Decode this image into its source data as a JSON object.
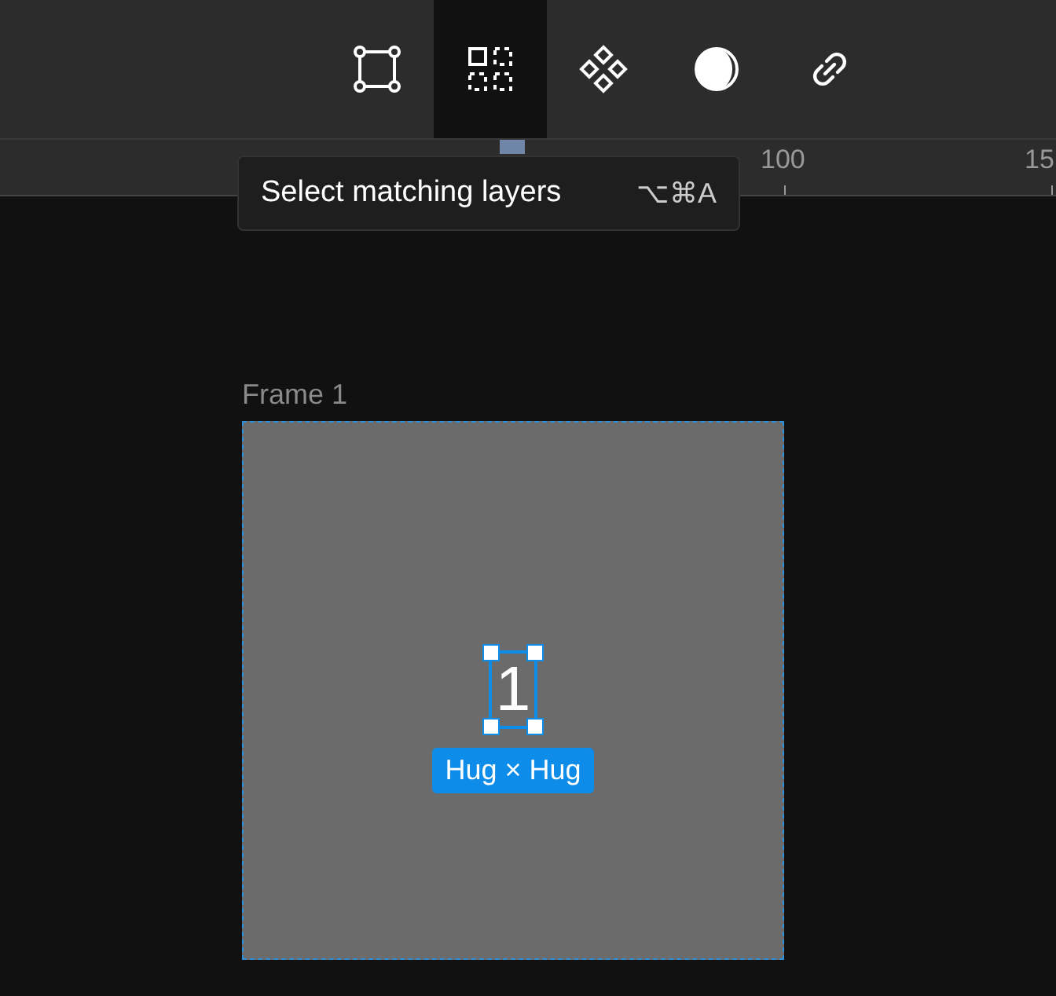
{
  "toolbar": {
    "buttons": [
      {
        "selected": false
      },
      {
        "selected": true
      },
      {
        "selected": false
      },
      {
        "selected": false
      },
      {
        "selected": false
      }
    ]
  },
  "ruler": {
    "labels": [
      {
        "text": "100"
      },
      {
        "text": "15"
      }
    ]
  },
  "tooltip": {
    "label": "Select matching layers",
    "shortcut": "⌥⌘A"
  },
  "canvas": {
    "frame": {
      "title": "Frame 1",
      "text_layer": "1",
      "size_badge": "Hug × Hug"
    }
  }
}
